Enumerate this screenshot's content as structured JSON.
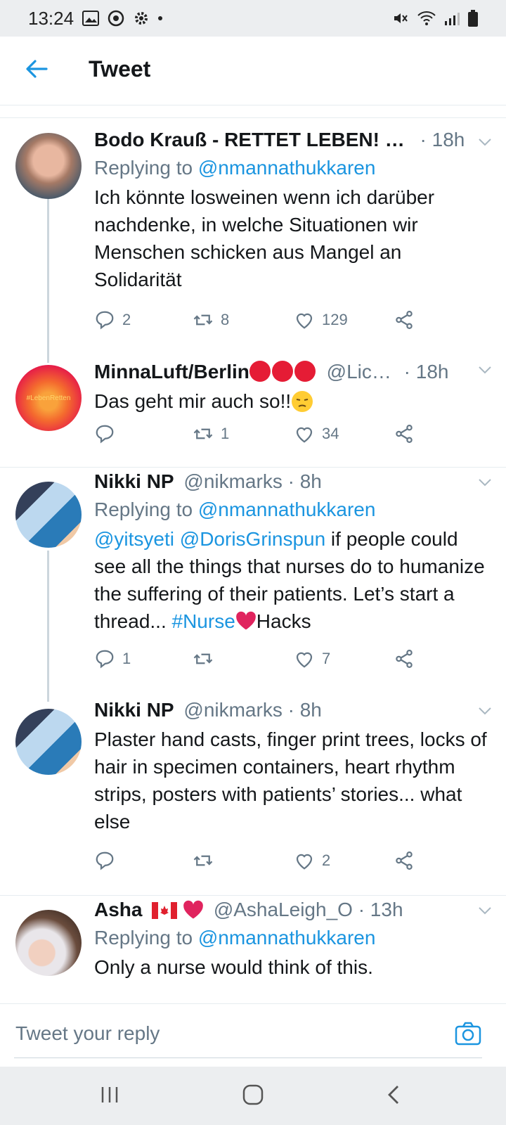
{
  "status_bar": {
    "time": "13:24"
  },
  "header": {
    "title": "Tweet"
  },
  "tweets": [
    {
      "name": "Bodo Krauß - RETTET LEBEN! …",
      "handle": "",
      "time": "· 18h",
      "replying_prefix": "Replying to ",
      "replying_to": "@nmannathukkaren",
      "text": "Ich könnte losweinen wenn ich darüber nachdenke, in welche Situationen wir Menschen schicken aus Mangel an Solidarität",
      "replies": "2",
      "retweets": "8",
      "likes": "129"
    },
    {
      "name": "MinnaLuft/Berlin",
      "handle": "@Lic…",
      "time": "· 18h",
      "avatar_text": "#LebenRetten",
      "text": "Das geht mir auch so!!",
      "replies": "",
      "retweets": "1",
      "likes": "34"
    },
    {
      "name": "Nikki NP",
      "handle": "@nikmarks",
      "time": "· 8h",
      "replying_prefix": "Replying to ",
      "replying_to": "@nmannathukkaren",
      "mention1": "@yitsyeti",
      "mention2": "@DorisGrinspun",
      "text_a": " if people could see all the things that nurses do to humanize the suffering of their patients. Let’s start a thread... ",
      "hashtag": "#Nurse",
      "text_b": "Hacks",
      "replies": "1",
      "retweets": "",
      "likes": "7"
    },
    {
      "name": "Nikki NP",
      "handle": "@nikmarks",
      "time": "· 8h",
      "text": "Plaster hand casts, finger print trees, locks of hair in specimen containers, heart rhythm strips, posters with patients’ stories... what else",
      "replies": "",
      "retweets": "",
      "likes": "2"
    },
    {
      "name": "Asha",
      "handle": "@AshaLeigh_O",
      "time": "· 13h",
      "replying_prefix": "Replying to ",
      "replying_to": "@nmannathukkaren",
      "text": "Only a nurse would think of this."
    }
  ],
  "reply_bar": {
    "placeholder": "Tweet your reply"
  },
  "colors": {
    "link": "#1b95e0",
    "muted": "#657786",
    "heart": "#e0245e"
  }
}
